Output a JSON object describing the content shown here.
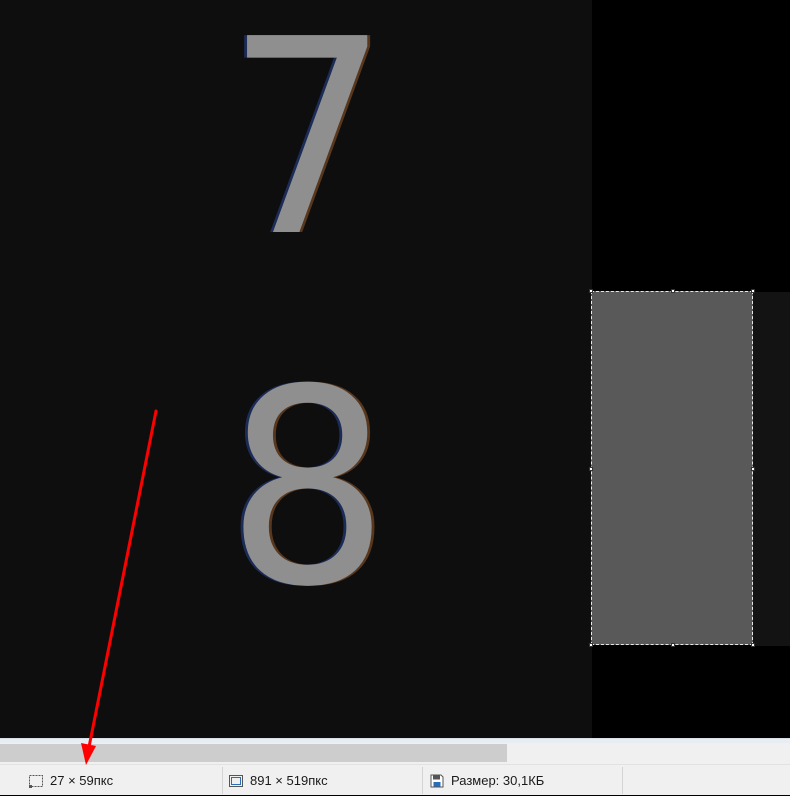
{
  "canvas": {
    "digits": [
      "7",
      "8"
    ]
  },
  "statusbar": {
    "selection_size": "27 × 59пкс",
    "image_size": "891 × 519пкс",
    "file_size": "Размер: 30,1КБ",
    "selection_icon": "selection-icon",
    "image_icon": "image-size-icon",
    "file_icon": "floppy-disk-icon"
  },
  "annotation": {
    "color": "#ff0000",
    "icon": "red-arrow-icon"
  },
  "colors": {
    "canvas_background": "#0e0e0e",
    "selection_fill": "#595959",
    "statusbar_background": "#f0f0f0"
  }
}
